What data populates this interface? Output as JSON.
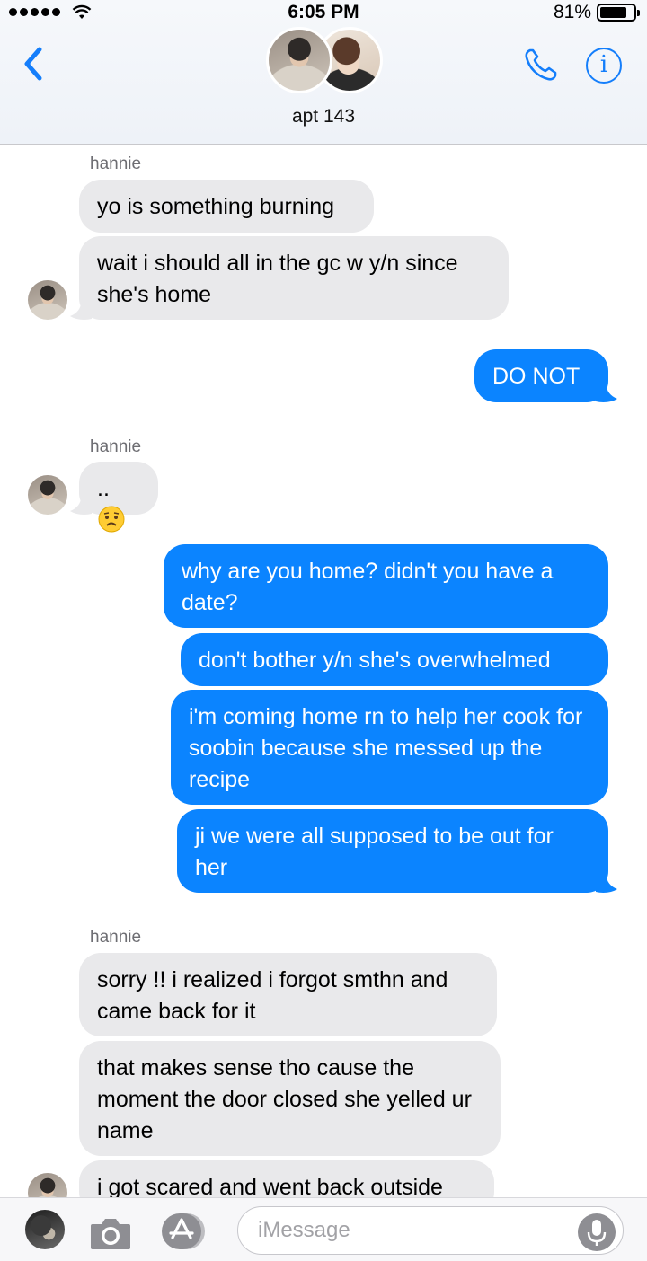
{
  "status_bar": {
    "time": "6:05 PM",
    "battery": "81%",
    "battery_level": 0.81
  },
  "header": {
    "title": "apt 143"
  },
  "messages": [
    {
      "sender": "hannie"
    },
    {
      "text": "yo is something burning"
    },
    {
      "text": "wait i should all in the gc w y/n since she's home"
    },
    {
      "text": "DO NOT"
    },
    {
      "sender": "hannie"
    },
    {
      "text": ".."
    },
    {
      "text": "why are you home? didn't you have a date?"
    },
    {
      "text": "don't bother y/n she's overwhelmed"
    },
    {
      "text": "i'm coming home rn to help her cook for soobin because she messed up the recipe"
    },
    {
      "text": "ji we were all supposed to be out for her"
    },
    {
      "sender": "hannie"
    },
    {
      "text": "sorry !! i realized i forgot smthn and came back for it"
    },
    {
      "text": "that makes sense tho cause the moment the door closed she yelled ur name"
    },
    {
      "text": "i got scared and went back outside"
    }
  ],
  "emoji": "worried-face",
  "input": {
    "placeholder": "iMessage"
  },
  "icons": {
    "back": "chevron-left-icon",
    "call": "phone-icon",
    "info": "info-icon",
    "camera": "camera-icon",
    "apps": "app-store-icon",
    "mic": "microphone-icon"
  },
  "colors": {
    "accent": "#147efb",
    "outgoing_bubble": "#0b84ff",
    "incoming_bubble": "#e9e9eb"
  }
}
